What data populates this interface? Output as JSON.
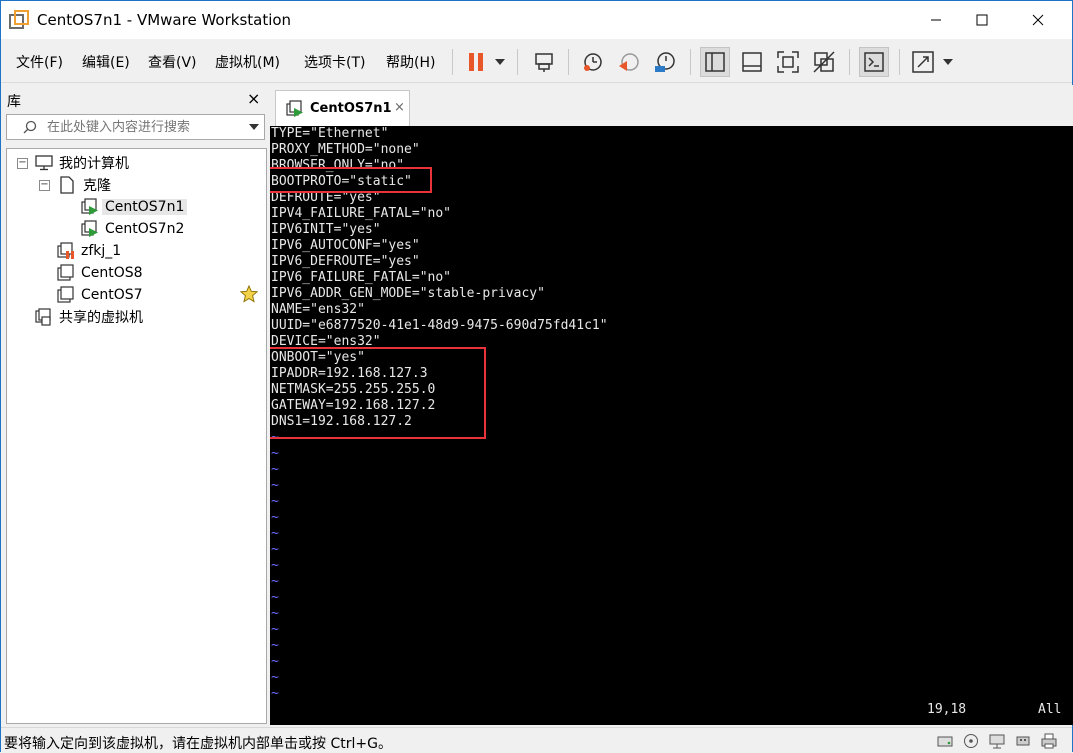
{
  "window": {
    "title": "CentOS7n1 - VMware Workstation",
    "icons": [
      "vmware-app-icon",
      "minimize-icon",
      "maximize-icon",
      "close-icon"
    ]
  },
  "menu": {
    "items": [
      {
        "label": "文件(F)"
      },
      {
        "label": "编辑(E)"
      },
      {
        "label": "查看(V)"
      },
      {
        "label": "虚拟机(M)"
      },
      {
        "label": "选项卡(T)"
      },
      {
        "label": "帮助(H)"
      }
    ]
  },
  "toolbar": {
    "icons": [
      "pause-icon",
      "dropdown-icon",
      "send-ctrl-alt-del-icon",
      "snapshot-take-icon",
      "snapshot-revert-icon",
      "snapshot-manager-icon",
      "library-view-icon",
      "thumbnail-bar-icon",
      "fullscreen-icon",
      "unity-icon",
      "console-view-icon",
      "stretch-icon",
      "dropdown-icon"
    ],
    "accent": "#e8572a"
  },
  "library": {
    "title": "库",
    "close_label": "×",
    "search_placeholder": "在此处键入内容进行搜索",
    "tree": {
      "root": "我的计算机",
      "clone_folder": "克隆",
      "vm1": "CentOS7n1",
      "vm2": "CentOS7n2",
      "vm3": "zfkj_1",
      "vm4": "CentOS8",
      "vm5": "CentOS7",
      "shared": "共享的虚拟机"
    }
  },
  "tab": {
    "label": "CentOS7n1",
    "close_label": "×"
  },
  "console": {
    "lines": [
      "TYPE=\"Ethernet\"",
      "PROXY_METHOD=\"none\"",
      "BROWSER_ONLY=\"no\"",
      "BOOTPROTO=\"static\"",
      "DEFROUTE=\"yes\"",
      "IPV4_FAILURE_FATAL=\"no\"",
      "IPV6INIT=\"yes\"",
      "IPV6_AUTOCONF=\"yes\"",
      "IPV6_DEFROUTE=\"yes\"",
      "IPV6_FAILURE_FATAL=\"no\"",
      "IPV6_ADDR_GEN_MODE=\"stable-privacy\"",
      "NAME=\"ens32\"",
      "UUID=\"e6877520-41e1-48d9-9475-690d75fd41c1\"",
      "DEVICE=\"ens32\"",
      "ONBOOT=\"yes\"",
      "IPADDR=192.168.127.3",
      "NETMASK=255.255.255.0",
      "GATEWAY=192.168.127.2",
      "DNS1=192.168.127.2"
    ],
    "tilde": "~",
    "tilde_count": 17,
    "cursor_pos": "19,18",
    "view": "All",
    "highlight_color": "#e8333a"
  },
  "status": {
    "text": "要将输入定向到该虚拟机，请在虚拟机内部单击或按 Ctrl+G。",
    "icons": [
      "hdd-icon",
      "cdrom-icon",
      "network-icon",
      "usb-icon",
      "printer-icon"
    ]
  }
}
